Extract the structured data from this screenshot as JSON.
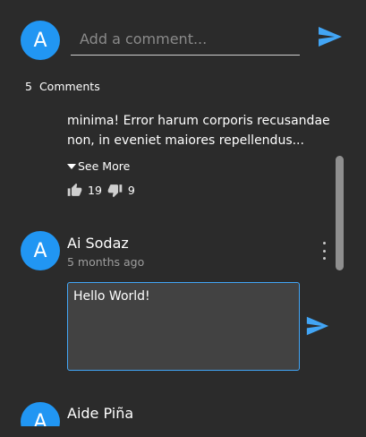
{
  "colors": {
    "background": "#2b2b2b",
    "accent": "#2196f3",
    "send_icon": "#42a5f5",
    "muted_text": "#9e9e9e",
    "scrollbar": "#8f8f8f"
  },
  "add_comment": {
    "avatar_letter": "A",
    "placeholder": "Add a comment...",
    "send_icon": "send-icon"
  },
  "comments_header": {
    "count": "5",
    "label": "Comments"
  },
  "comments": [
    {
      "text_lines": [
        "minima! Error harum corporis recusandae",
        "non, in eveniet maiores repellendus..."
      ],
      "see_more_label": "See More",
      "likes": "19",
      "dislikes": "9"
    },
    {
      "avatar_letter": "A",
      "author": "Ai Sodaz",
      "time": "5 months ago",
      "edit_value": "Hello World!",
      "menu_icon": "more-vertical-icon",
      "send_icon": "send-icon"
    },
    {
      "avatar_letter": "A",
      "author": "Aide Piña"
    }
  ]
}
